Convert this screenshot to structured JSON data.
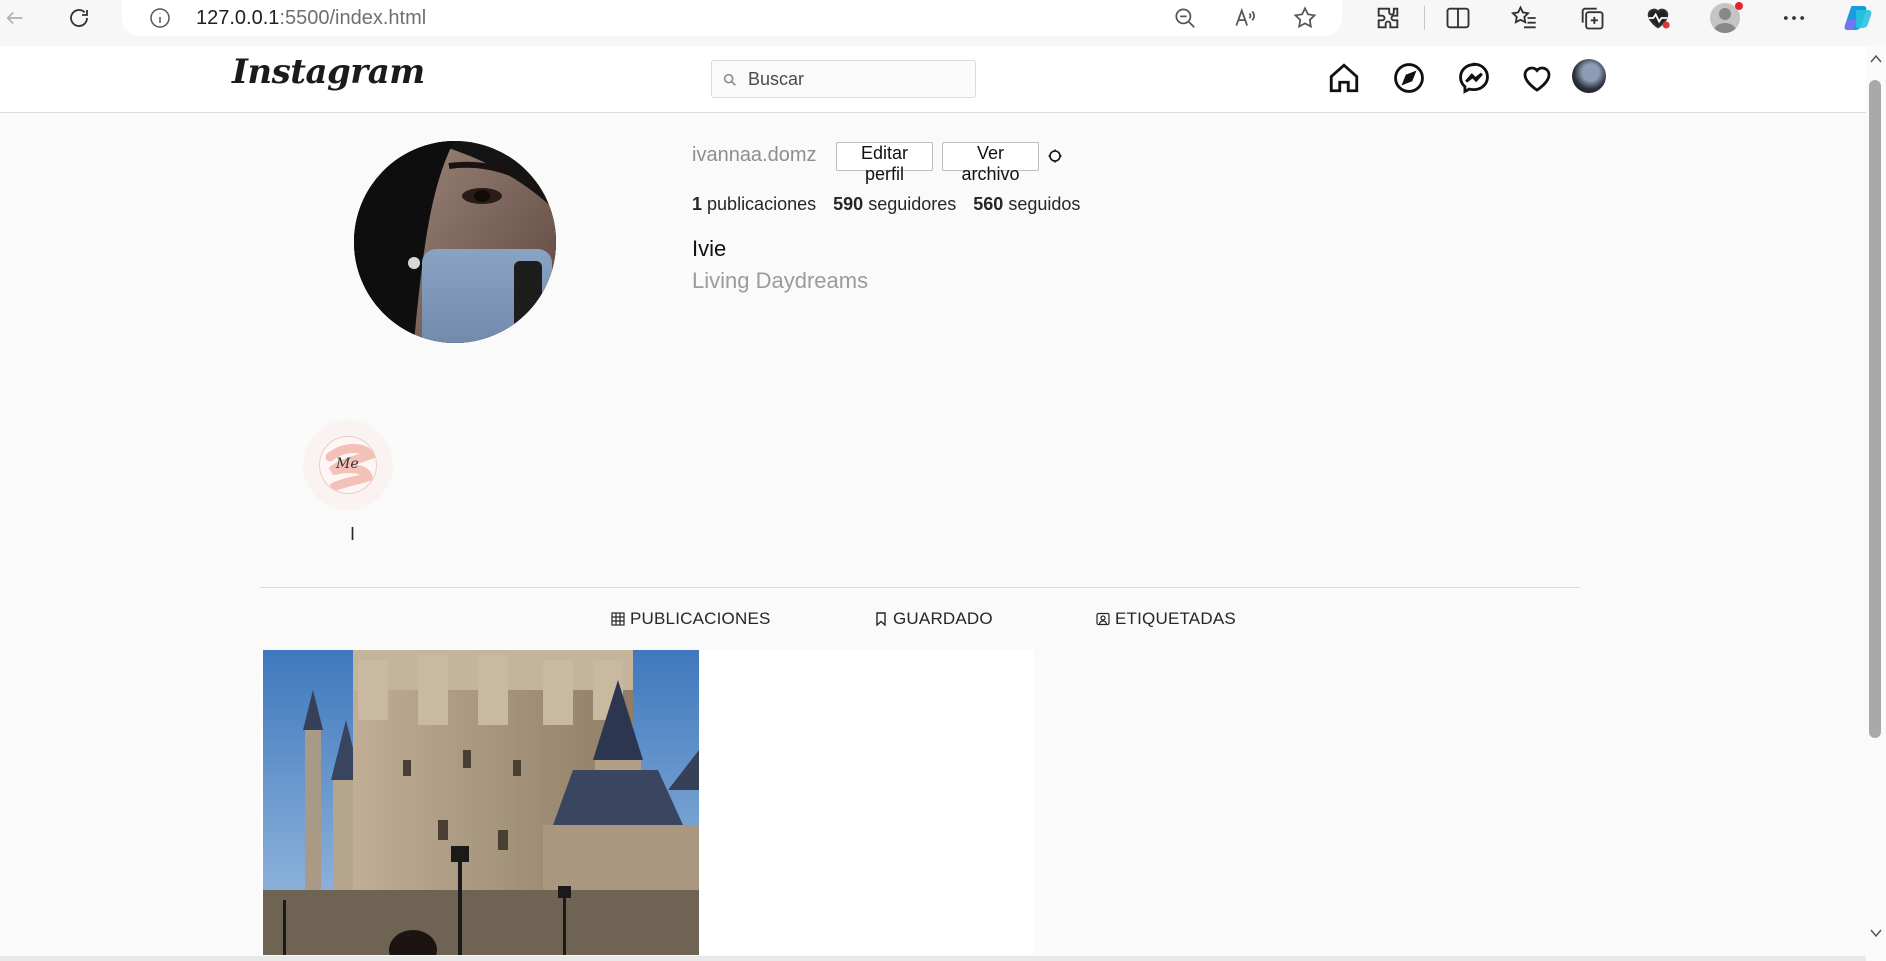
{
  "browser": {
    "url_host": "127.0.0.1",
    "url_path": ":5500/index.html"
  },
  "header": {
    "logo": "Instagram",
    "search_placeholder": "Buscar"
  },
  "profile": {
    "username": "ivannaa.domz",
    "edit_button": "Editar perfil",
    "archive_button": "Ver archivo",
    "posts_count": "1",
    "posts_label": "publicaciones",
    "followers_count": "590",
    "followers_label": "seguidores",
    "following_count": "560",
    "following_label": "seguidos",
    "name": "Ivie",
    "bio": "Living Daydreams"
  },
  "highlight": {
    "cover_text": "Me",
    "label": "I"
  },
  "tabs": [
    {
      "label": "PUBLICACIONES",
      "icon": "grid-icon"
    },
    {
      "label": "GUARDADO",
      "icon": "bookmark-icon"
    },
    {
      "label": "ETIQUETADAS",
      "icon": "tag-user-icon"
    }
  ],
  "colors": {
    "page_bg": "#fafafa",
    "border": "#dbdbdb",
    "muted_text": "#8e8e8e",
    "text": "#262626"
  }
}
